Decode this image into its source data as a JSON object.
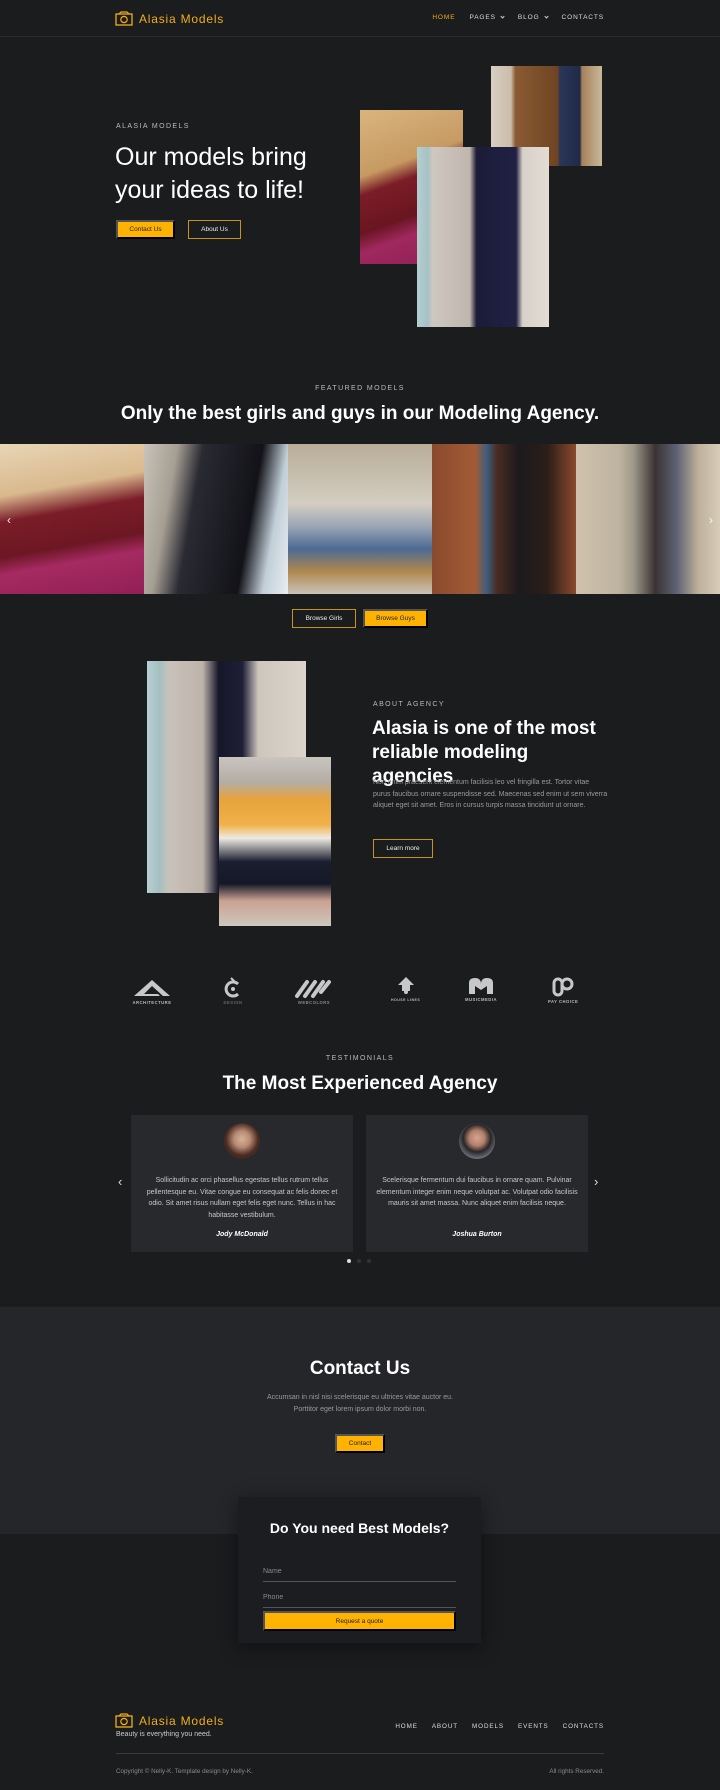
{
  "brand": {
    "name": "Alasia Models",
    "accent_color": "#f2ad18",
    "button_color": "#ffb300"
  },
  "nav": {
    "items": [
      {
        "label": "HOME",
        "active": true
      },
      {
        "label": "PAGES",
        "dropdown": true
      },
      {
        "label": "BLOG",
        "dropdown": true
      },
      {
        "label": "CONTACTS"
      }
    ]
  },
  "hero": {
    "eyebrow": "ALASIA MODELS",
    "title": "Our models bring your ideas to life!",
    "contact_button": "Contact Us",
    "about_button": "About Us"
  },
  "featured": {
    "eyebrow": "FEATURED MODELS",
    "title": "Only the best girls and guys in our Modeling Agency.",
    "prev_icon": "‹",
    "next_icon": "›",
    "browse_girls": "Browse Girls",
    "browse_guys": "Browse Guys"
  },
  "about": {
    "eyebrow": "ABOUT AGENCY",
    "title": "Alasia is one of the most reliable modeling agencies",
    "text": "Non enim praesent elementum facilisis leo vel fringilla est. Tortor vitae purus faucibus ornare suspendisse sed. Maecenas sed enim ut sem viverra aliquet eget sit amet. Eros in cursus turpis massa tincidunt ut ornare.",
    "button": "Learn more"
  },
  "partners": [
    {
      "name": "ARCHITECTURE"
    },
    {
      "name": "DESIGN"
    },
    {
      "name": "WEBCOLORS"
    },
    {
      "name": "HOUSE LINES"
    },
    {
      "name": "MUSICMEDIA"
    },
    {
      "name": "PAY CHOICE"
    }
  ],
  "testimonials": {
    "eyebrow": "TESTIMONIALS",
    "title": "The Most Experienced Agency",
    "prev_icon": "‹",
    "next_icon": "›",
    "items": [
      {
        "quote": "Sollicitudin ac orci phasellus egestas tellus rutrum tellus pellentesque eu. Vitae congue eu consequat ac felis donec et odio. Sit amet risus nullam eget felis eget nunc. Tellus in hac habitasse vestibulum.",
        "author": "Jody McDonald"
      },
      {
        "quote": "Scelerisque fermentum dui faucibus in ornare quam. Pulvinar elementum integer enim neque volutpat ac. Volutpat odio facilisis mauris sit amet massa. Nunc aliquet enim facilisis neque.",
        "author": "Joshua Burton"
      }
    ],
    "page_count": 3,
    "active_page": 1
  },
  "contact": {
    "title": "Contact Us",
    "text_line1": "Accumsan in nisl nisi scelerisque eu ultrices vitae auctor eu.",
    "text_line2": "Porttitor eget lorem ipsum dolor morbi non.",
    "button": "Contact"
  },
  "quote_form": {
    "title": "Do You need Best Models?",
    "name_placeholder": "Name",
    "phone_placeholder": "Phone",
    "submit": "Request a quote"
  },
  "footer": {
    "brand_name": "Alasia Models",
    "tagline": "Beauty is everything you need.",
    "nav": [
      "HOME",
      "ABOUT",
      "MODELS",
      "EVENTS",
      "CONTACTS"
    ],
    "copyright": "Copyright © Nelly-K. Template design by Nelly-K.",
    "rights": "All rights Reserved."
  }
}
